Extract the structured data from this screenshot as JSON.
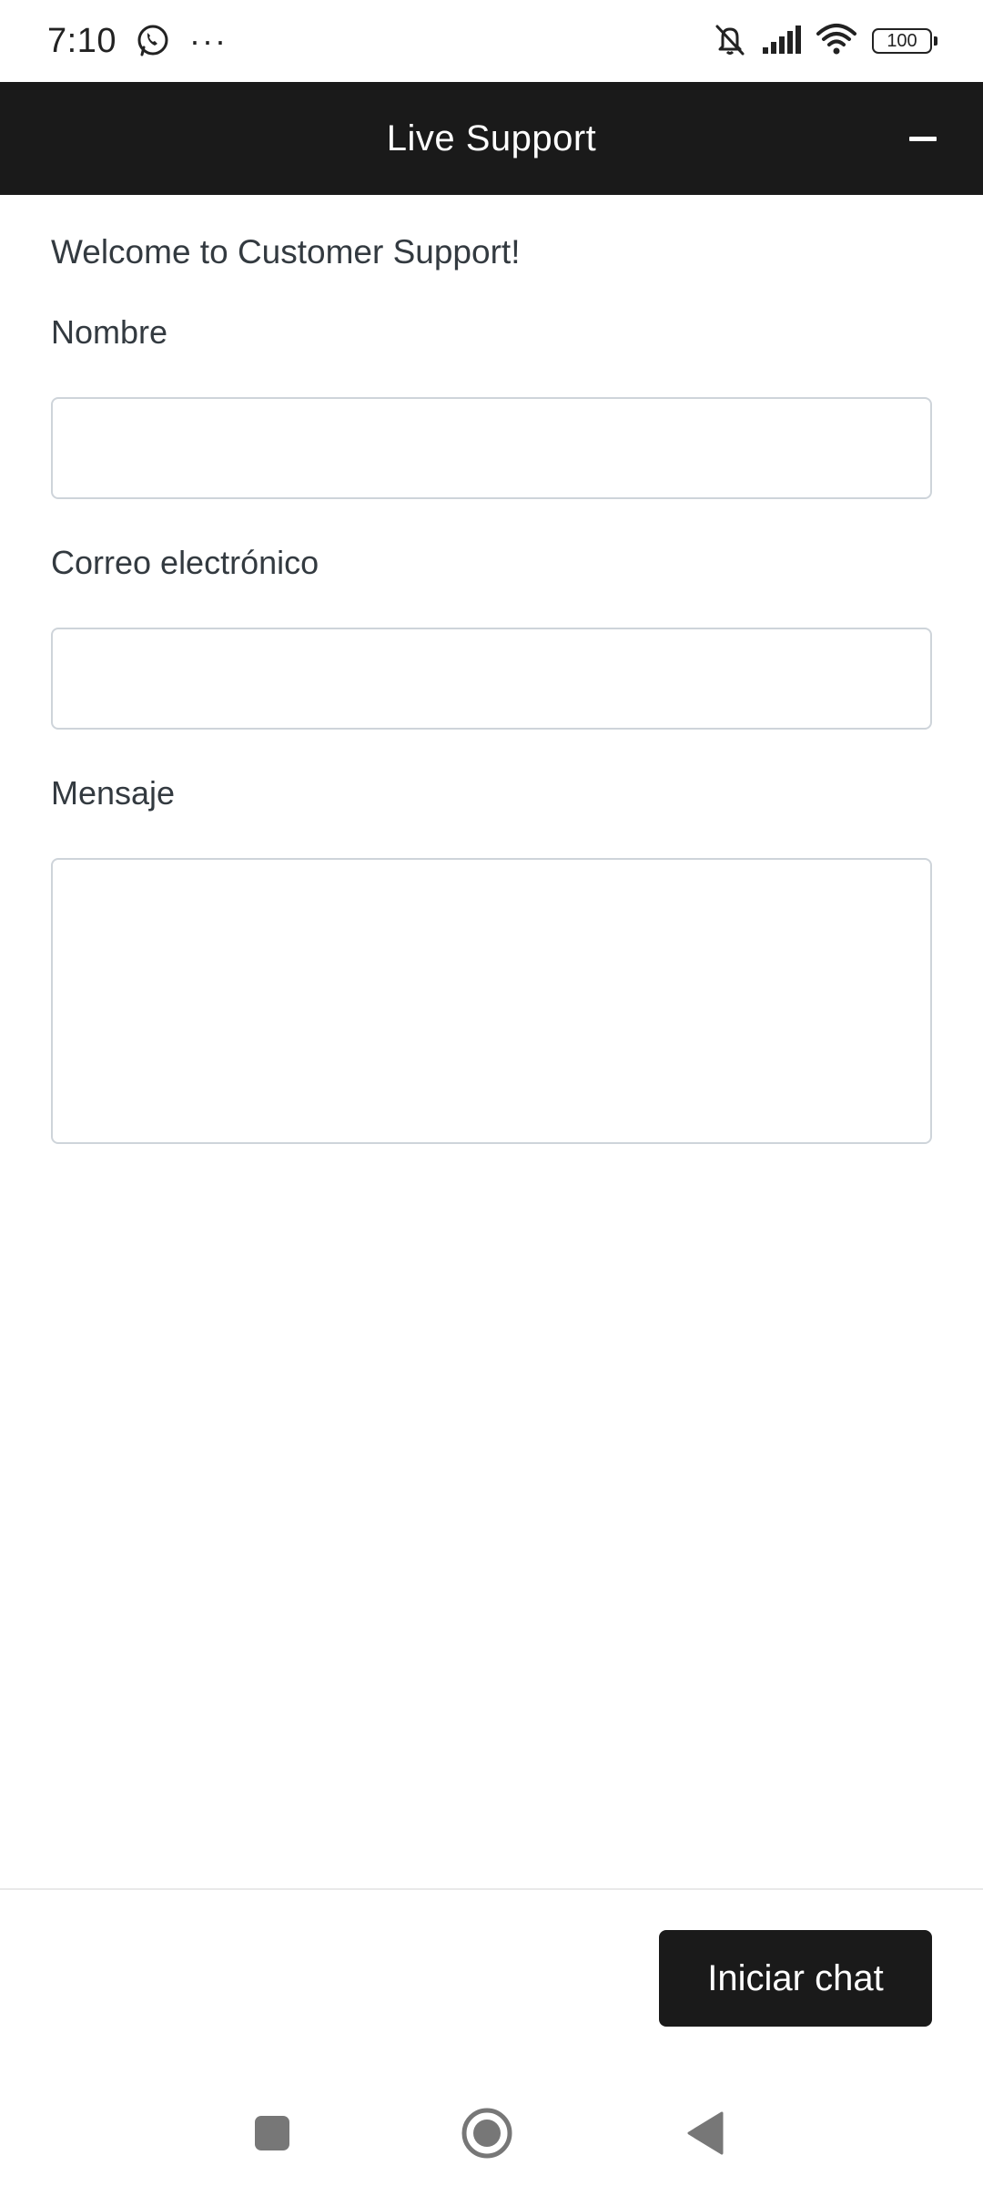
{
  "status_bar": {
    "time": "7:10",
    "overflow": "···",
    "battery": "100",
    "icons": [
      "whatsapp-icon",
      "bell-muted-icon",
      "signal-icon",
      "wifi-icon",
      "battery-icon"
    ]
  },
  "header": {
    "title": "Live Support",
    "minimize_icon": "minimize-icon"
  },
  "form": {
    "welcome": "Welcome to Customer Support!",
    "name_label": "Nombre",
    "name_value": "",
    "email_label": "Correo electrónico",
    "email_value": "",
    "message_label": "Mensaje",
    "message_value": ""
  },
  "footer": {
    "start_button": "Iniciar chat"
  },
  "nav_bar": {
    "icons": [
      "recents-icon",
      "home-icon",
      "back-icon"
    ]
  },
  "colors": {
    "header_bg": "#1a1a1a",
    "button_bg": "#1a1a1a",
    "text": "#333a40",
    "input_border": "#ced4da"
  }
}
